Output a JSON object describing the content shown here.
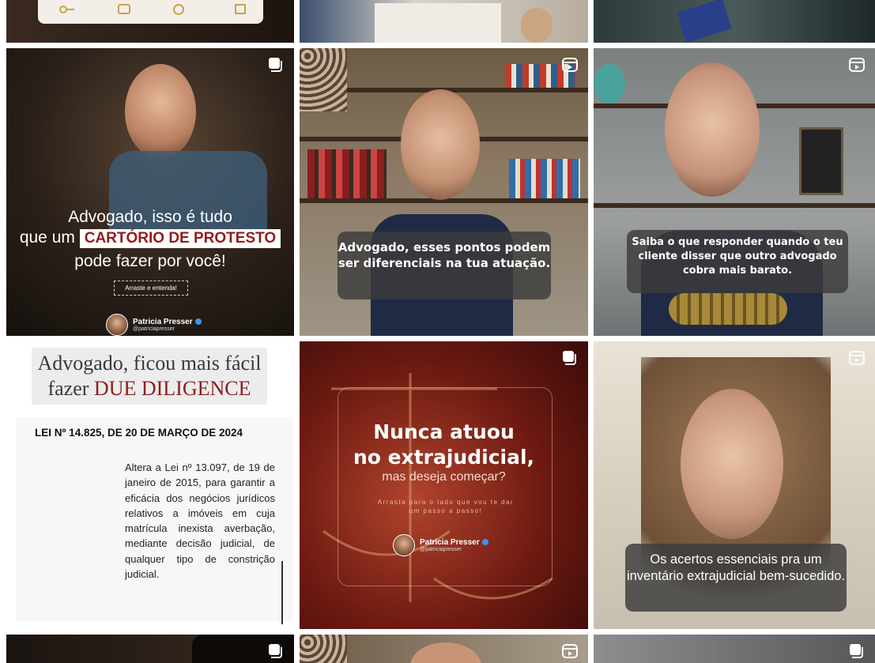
{
  "top_row": {
    "tiles": [
      "tile-top-1",
      "tile-top-2",
      "tile-top-3"
    ]
  },
  "icons": {
    "carousel": "carousel-icon",
    "reel": "reel-icon"
  },
  "posts": {
    "cartorio": {
      "line1": "Advogado, isso é tudo",
      "line2_prefix": "que um",
      "highlight": "CARTÓRIO DE PROTESTO",
      "line3": "pode fazer por você!",
      "button": "Arraste e entenda!",
      "profile_name": "Patricia Presser",
      "profile_handle": "@patriciapresser"
    },
    "pontos": {
      "caption": "Advogado, esses pontos podem ser diferenciais na tua atuação."
    },
    "saiba": {
      "caption": "Saiba o que responder quando o teu cliente disser que outro advogado cobra mais barato."
    },
    "due": {
      "title_line1": "Advogado, ficou mais fácil",
      "title_prefix": "fazer",
      "title_highlight": "DUE DILIGENCE",
      "lei": "LEI Nº 14.825, DE 20 DE MARÇO DE 2024",
      "body": "Altera a Lei nº 13.097, de 19 de janeiro de 2015, para garantir a eficácia dos negócios jurídicos relativos a imóveis em cuja matrícula inexista averbação, mediante decisão judicial, de qualquer tipo de constrição judicial."
    },
    "nunca": {
      "line1": "Nunca atuou",
      "line2": "no extrajudicial,",
      "line3": "mas deseja começar?",
      "arrasta": "Arrasta para o lado que vou te dar um passo a passo!",
      "profile_name": "Patricia Presser",
      "profile_handle": "@patriciapresser"
    },
    "acertos": {
      "caption": "Os acertos essenciais pra um inventário extrajudicial bem-sucedido."
    }
  },
  "colors": {
    "accent_red": "#8f1d1d",
    "verified_blue": "#3897f0",
    "bubble": "#3c3c3c"
  }
}
